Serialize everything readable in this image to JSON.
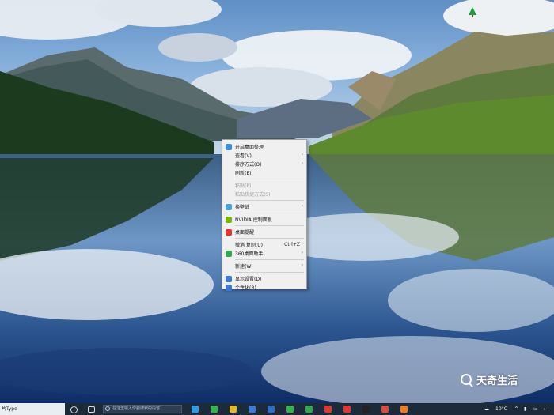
{
  "context_menu": {
    "items": [
      {
        "label": "开启桌面整理",
        "disabled": false,
        "submenu": false,
        "icon": "desktop-organize-icon",
        "icon_color": "#3c8de0"
      },
      {
        "label": "查看(V)",
        "disabled": false,
        "submenu": true
      },
      {
        "label": "排序方式(O)",
        "disabled": false,
        "submenu": true
      },
      {
        "label": "刷新(E)",
        "disabled": false,
        "submenu": false
      },
      {
        "sep": true
      },
      {
        "label": "粘贴(P)",
        "disabled": true,
        "submenu": false
      },
      {
        "label": "粘贴快捷方式(S)",
        "disabled": true,
        "submenu": false
      },
      {
        "sep": true
      },
      {
        "label": "换壁纸",
        "disabled": false,
        "submenu": true,
        "icon": "wallpaper-icon",
        "icon_color": "#4aa3df"
      },
      {
        "sep": true
      },
      {
        "label": "NVIDIA 控制面板",
        "disabled": false,
        "submenu": false,
        "icon": "nvidia-icon",
        "icon_color": "#76b900"
      },
      {
        "sep": true
      },
      {
        "label": "桌面提醒",
        "disabled": false,
        "submenu": false,
        "icon": "wps-icon",
        "icon_color": "#e0382e"
      },
      {
        "sep": true
      },
      {
        "label": "撤消 复制(U)",
        "disabled": false,
        "submenu": false,
        "shortcut": "Ctrl+Z"
      },
      {
        "label": "360桌面助手",
        "disabled": false,
        "submenu": true,
        "icon": "360-icon",
        "icon_color": "#2fa84f"
      },
      {
        "sep": true
      },
      {
        "label": "新建(W)",
        "disabled": false,
        "submenu": true
      },
      {
        "sep": true
      },
      {
        "label": "显示设置(D)",
        "disabled": false,
        "submenu": false,
        "icon": "display-settings-icon",
        "icon_color": "#3a7bd5"
      },
      {
        "label": "个性化(R)",
        "disabled": false,
        "submenu": false,
        "icon": "personalize-icon",
        "icon_color": "#3a7bd5"
      }
    ]
  },
  "watermark": {
    "text": "天奇生活"
  },
  "taskbar": {
    "left_text": "片Type",
    "search_placeholder": "在这里输入你要搜索的内容",
    "temperature": "10°C",
    "pinned_icons": [
      {
        "name": "edge-icon",
        "color": "#2b9ee8"
      },
      {
        "name": "wechat-file-icon",
        "color": "#31b54b"
      },
      {
        "name": "explorer-icon",
        "color": "#e8b62e"
      },
      {
        "name": "store-icon",
        "color": "#3a7bd5"
      },
      {
        "name": "photoshop-icon",
        "color": "#2b6dc9"
      },
      {
        "name": "wechat-icon",
        "color": "#31b54b"
      },
      {
        "name": "browser-360-icon",
        "color": "#2fa84f"
      },
      {
        "name": "wps-icon",
        "color": "#e0382e"
      },
      {
        "name": "wps-office-icon",
        "color": "#e0382e"
      },
      {
        "name": "capcut-icon",
        "color": "#222222"
      },
      {
        "name": "app-red-icon",
        "color": "#d84a3a"
      },
      {
        "name": "firefox-icon",
        "color": "#ef7d20"
      }
    ]
  }
}
